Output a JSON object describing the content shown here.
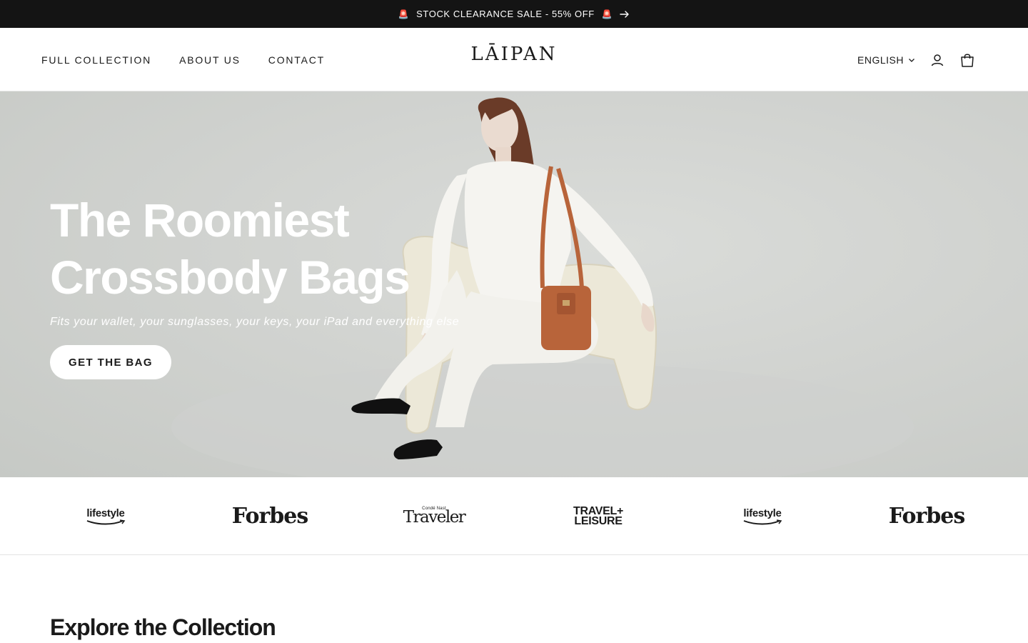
{
  "announcement": {
    "text": "STOCK CLEARANCE SALE - 55% OFF",
    "left_emoji": "🚨",
    "right_emoji": "🚨"
  },
  "header": {
    "nav": [
      "FULL COLLECTION",
      "ABOUT US",
      "CONTACT"
    ],
    "logo": "LĀIPAN",
    "language": "ENGLISH"
  },
  "hero": {
    "title_line1": "The Roomiest",
    "title_line2": "Crossbody Bags",
    "subtitle": "Fits your wallet, your sunglasses, your keys, your iPad and everything else",
    "cta": "GET THE BAG"
  },
  "press": {
    "logos": [
      "lifestyle",
      "Forbes",
      "Traveler",
      "TRAVEL+ LEISURE",
      "lifestyle",
      "Forbes"
    ],
    "traveler_prefix": "Condé Nast",
    "tl_line1": "TRAVEL+",
    "tl_line2": "LEISURE"
  },
  "section": {
    "heading": "Explore the Collection"
  },
  "colors": {
    "announcement_bg": "#141414",
    "hero_text": "#ffffff",
    "bag": "#b8643a"
  }
}
